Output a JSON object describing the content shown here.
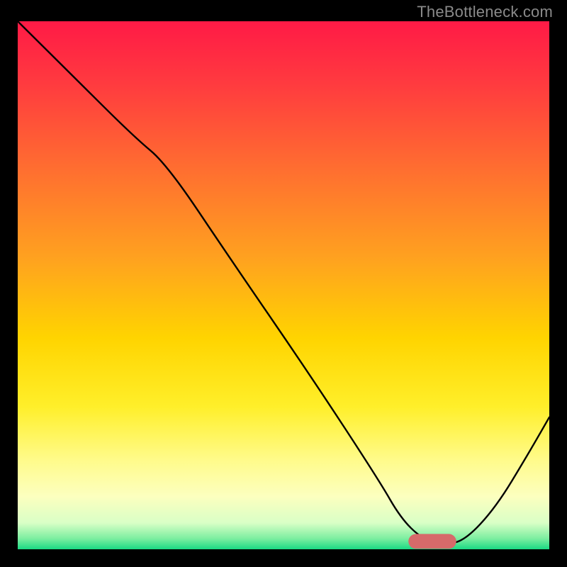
{
  "watermark": "TheBottleneck.com",
  "chart_data": {
    "type": "line",
    "title": "",
    "xlabel": "",
    "ylabel": "",
    "xlim": [
      0,
      100
    ],
    "ylim": [
      0,
      100
    ],
    "background_gradient": {
      "stops": [
        {
          "offset": 0,
          "color": "#ff1a46"
        },
        {
          "offset": 12,
          "color": "#ff3b3f"
        },
        {
          "offset": 28,
          "color": "#ff6e30"
        },
        {
          "offset": 45,
          "color": "#ffa21f"
        },
        {
          "offset": 60,
          "color": "#ffd400"
        },
        {
          "offset": 73,
          "color": "#ffef2a"
        },
        {
          "offset": 83,
          "color": "#fffb8a"
        },
        {
          "offset": 90,
          "color": "#fcffbf"
        },
        {
          "offset": 95,
          "color": "#d9ffc6"
        },
        {
          "offset": 98,
          "color": "#7beea0"
        },
        {
          "offset": 100,
          "color": "#1ad984"
        }
      ]
    },
    "series": [
      {
        "name": "bottleneck-curve",
        "color": "#000000",
        "stroke_width": 2.4,
        "x": [
          0,
          10,
          22,
          28,
          40,
          55,
          68,
          72,
          76,
          80,
          84,
          90,
          96,
          100
        ],
        "y": [
          100,
          90,
          78,
          73,
          55,
          33,
          13,
          6,
          2,
          1,
          1.5,
          8,
          18,
          25
        ]
      }
    ],
    "marker": {
      "name": "optimal-range",
      "shape": "rounded-rect",
      "color": "#d66a6a",
      "x_center": 78,
      "y_center": 1.5,
      "width": 9,
      "height": 2.8,
      "rx": 1.4
    }
  }
}
